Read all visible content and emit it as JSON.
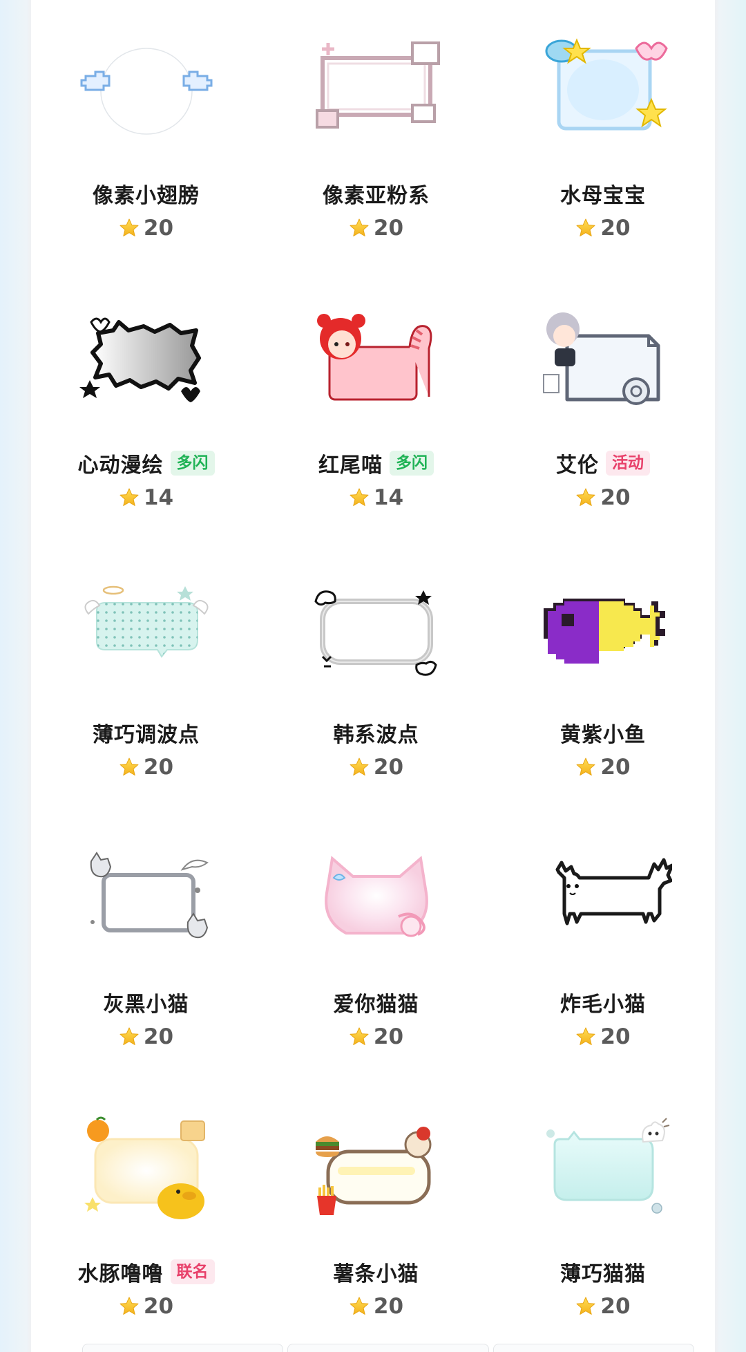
{
  "items": [
    {
      "name": "像素小翅膀",
      "price": "20",
      "tag": "",
      "tag_color": "",
      "icon": "pixel-wings-frame-icon"
    },
    {
      "name": "像素亚粉系",
      "price": "20",
      "tag": "",
      "tag_color": "",
      "icon": "pixel-pink-frame-icon"
    },
    {
      "name": "水母宝宝",
      "price": "20",
      "tag": "",
      "tag_color": "",
      "icon": "jellyfish-frame-icon"
    },
    {
      "name": "心动漫绘",
      "price": "14",
      "tag": "多闪",
      "tag_color": "green",
      "icon": "comic-burst-frame-icon"
    },
    {
      "name": "红尾喵",
      "price": "14",
      "tag": "多闪",
      "tag_color": "green",
      "icon": "red-tail-cat-frame-icon"
    },
    {
      "name": "艾伦",
      "price": "20",
      "tag": "活动",
      "tag_color": "pink",
      "icon": "allen-character-frame-icon"
    },
    {
      "name": "薄巧调波点",
      "price": "20",
      "tag": "",
      "tag_color": "",
      "icon": "mint-polka-dot-frame-icon"
    },
    {
      "name": "韩系波点",
      "price": "20",
      "tag": "",
      "tag_color": "",
      "icon": "korean-dot-frame-icon"
    },
    {
      "name": "黄紫小鱼",
      "price": "20",
      "tag": "",
      "tag_color": "",
      "icon": "purple-yellow-fish-frame-icon"
    },
    {
      "name": "灰黑小猫",
      "price": "20",
      "tag": "",
      "tag_color": "",
      "icon": "gray-cat-frame-icon"
    },
    {
      "name": "爱你猫猫",
      "price": "20",
      "tag": "",
      "tag_color": "",
      "icon": "love-cat-frame-icon"
    },
    {
      "name": "炸毛小猫",
      "price": "20",
      "tag": "",
      "tag_color": "",
      "icon": "fluffy-cat-frame-icon"
    },
    {
      "name": "水豚噜噜",
      "price": "20",
      "tag": "联名",
      "tag_color": "pink",
      "icon": "capybara-frame-icon"
    },
    {
      "name": "薯条小猫",
      "price": "20",
      "tag": "",
      "tag_color": "",
      "icon": "fries-cat-frame-icon"
    },
    {
      "name": "薄巧猫猫",
      "price": "20",
      "tag": "",
      "tag_color": "",
      "icon": "mint-cat-frame-icon"
    }
  ],
  "colors": {
    "accent_green": "#20b356",
    "accent_pink": "#e8406a",
    "star": "#f7c531"
  }
}
